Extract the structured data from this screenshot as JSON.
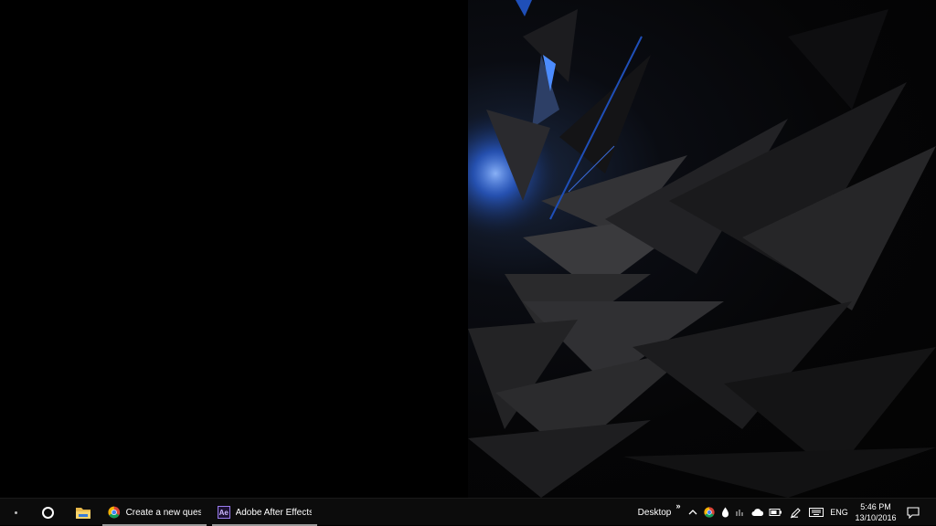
{
  "taskbar": {
    "start_icon": "windows-start-icon",
    "search_icon": "cortana-circle-icon",
    "pinned": [
      {
        "name": "file-explorer",
        "icon": "folder-icon"
      }
    ],
    "tasks": [
      {
        "label": "Create a new questi...",
        "icon": "chrome-icon",
        "active": true
      },
      {
        "label": "Adobe After Effects...",
        "icon": "after-effects-icon",
        "icon_text": "Ae",
        "active": true
      }
    ],
    "toolbar_label": "Desktop",
    "toolbar_overflow": "»",
    "tray": {
      "icons": [
        "chevron-up-icon",
        "chrome-icon",
        "droplet-icon",
        "cloud-icon",
        "network-icon",
        "battery-icon",
        "pen-icon",
        "keyboard-icon"
      ],
      "language": "ENG",
      "time": "5:46 PM",
      "date": "13/10/2016",
      "notification_icon": "action-center-icon"
    }
  },
  "colors": {
    "taskbar_bg": "#0c0c0c",
    "accent_blue": "#2f6fff",
    "ae_purple": "#9a7cf0"
  }
}
